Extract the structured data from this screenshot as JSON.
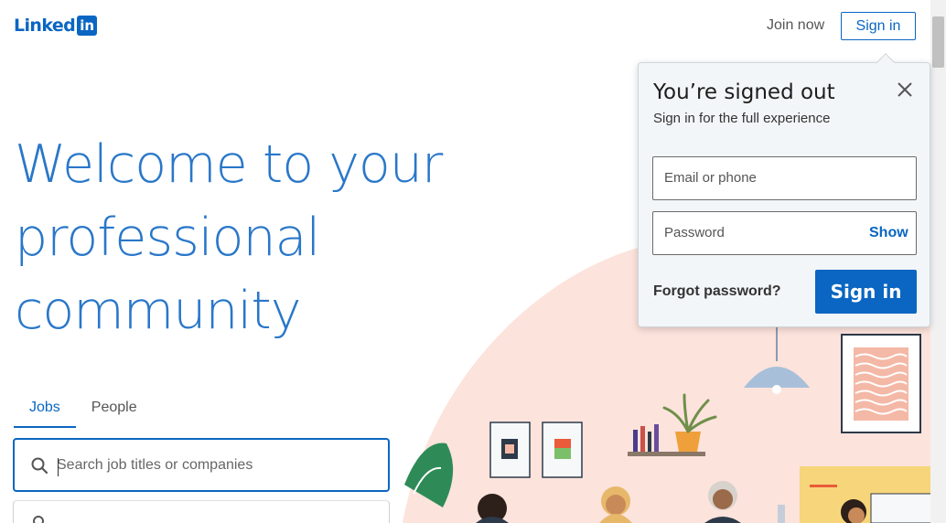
{
  "header": {
    "logo_text": "Linked",
    "logo_box": "in",
    "join_now": "Join now",
    "sign_in": "Sign in"
  },
  "hero": {
    "title": "Welcome to your professional community"
  },
  "tabs": [
    {
      "label": "Jobs",
      "active": true
    },
    {
      "label": "People",
      "active": false
    }
  ],
  "search": {
    "placeholder": "Search job titles or companies",
    "value": ""
  },
  "popup": {
    "title": "You’re signed out",
    "subtitle": "Sign in for the full experience",
    "email_placeholder": "Email or phone",
    "password_placeholder": "Password",
    "show_label": "Show",
    "forgot_label": "Forgot password?",
    "sign_in_label": "Sign in"
  },
  "colors": {
    "brand": "#0a66c2",
    "hero_text": "#2977c9",
    "illustration_bg": "#fce3dc"
  },
  "icons": [
    "search-icon",
    "location-icon",
    "close-icon"
  ]
}
